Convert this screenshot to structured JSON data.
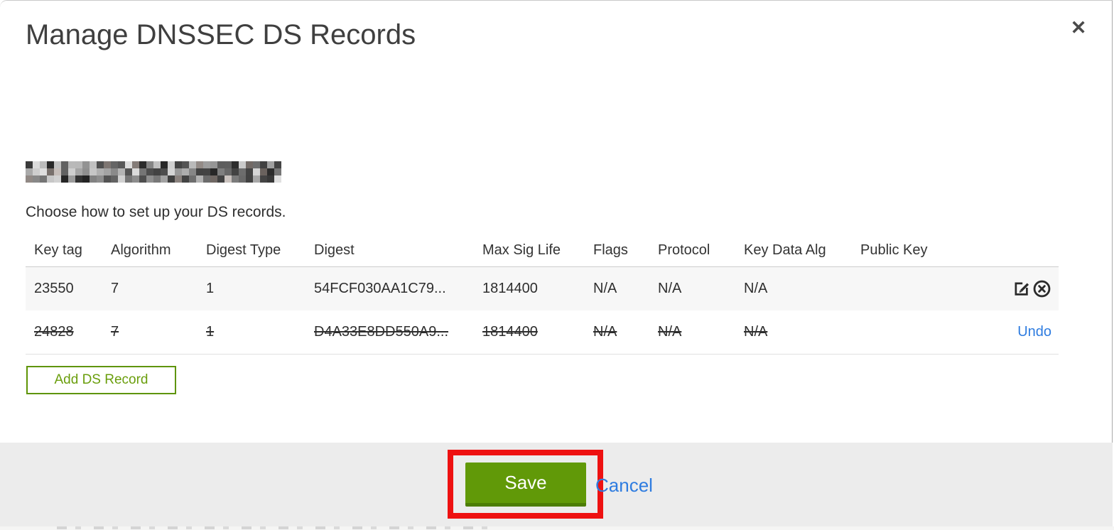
{
  "modal": {
    "title": "Manage DNSSEC DS Records",
    "close_label": "✕",
    "instruction": "Choose how to set up your DS records.",
    "domain_redacted": true
  },
  "table": {
    "columns": [
      "Key tag",
      "Algorithm",
      "Digest Type",
      "Digest",
      "Max Sig Life",
      "Flags",
      "Protocol",
      "Key Data Alg",
      "Public Key"
    ],
    "rows": [
      {
        "key_tag": "23550",
        "algorithm": "7",
        "digest_type": "1",
        "digest": "54FCF030AA1C79...",
        "max_sig_life": "1814400",
        "flags": "N/A",
        "protocol": "N/A",
        "key_data_alg": "N/A",
        "public_key": "",
        "state": "current",
        "actions": [
          "edit",
          "delete"
        ]
      },
      {
        "key_tag": "24828",
        "algorithm": "7",
        "digest_type": "1",
        "digest": "D4A33E8DD550A9...",
        "max_sig_life": "1814400",
        "flags": "N/A",
        "protocol": "N/A",
        "key_data_alg": "N/A",
        "public_key": "",
        "state": "deleted",
        "action_label": "Undo"
      }
    ]
  },
  "buttons": {
    "add_ds_record": "Add DS Record",
    "save": "Save",
    "cancel": "Cancel"
  },
  "annotations": {
    "highlight_target": "save-button",
    "highlight_color": "#ee1111"
  },
  "colors": {
    "primary_green": "#619908",
    "green_border": "#4c7d05",
    "link_blue": "#2e7ce0",
    "row_alt_gray": "#f7f7f7",
    "footer_gray": "#ececec"
  }
}
